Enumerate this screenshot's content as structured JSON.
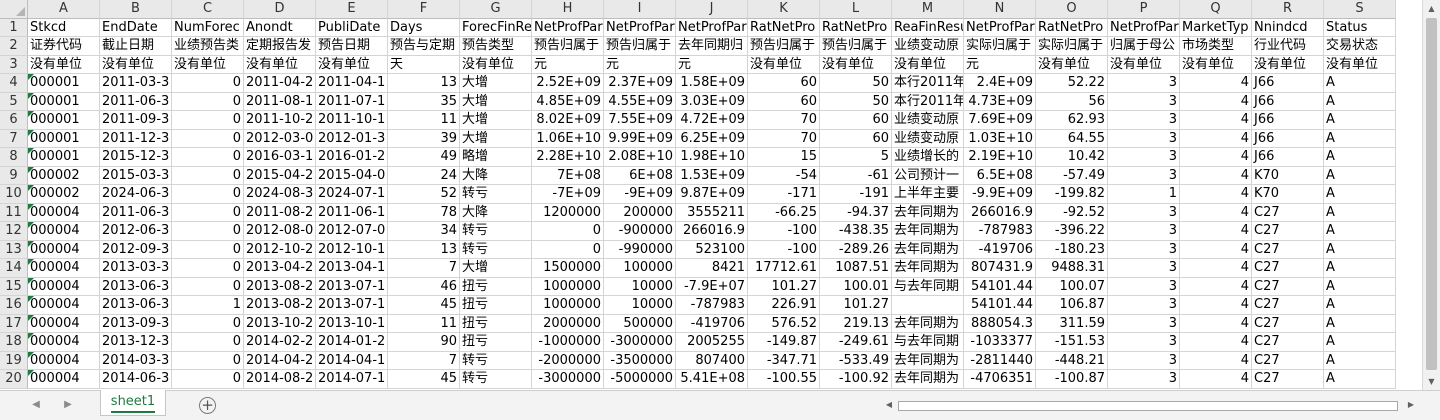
{
  "columns": [
    "A",
    "B",
    "C",
    "D",
    "E",
    "F",
    "G",
    "H",
    "I",
    "J",
    "K",
    "L",
    "M",
    "N",
    "O",
    "P",
    "Q",
    "R",
    "S"
  ],
  "rows": [
    [
      "Stkcd",
      "EndDate",
      "NumForec",
      "Anondt",
      "PubliDate",
      "Days",
      "ForecFinRe",
      "NetProfPar",
      "NetProfPar",
      "NetProfPar",
      "RatNetPro",
      "RatNetPro",
      "ReaFinResu",
      "NetProfPar",
      "RatNetPro",
      "NetProfPar",
      "MarketTyp",
      "Nnindcd",
      "Status"
    ],
    [
      "证券代码",
      "截止日期",
      "业绩预告类",
      "定期报告发",
      "预告日期",
      "预告与定期",
      "预告类型",
      "预告归属于",
      "预告归属于",
      "去年同期归",
      "预告归属于",
      "预告归属于",
      "业绩变动原",
      "实际归属于",
      "实际归属于",
      "归属于母公",
      "市场类型",
      "行业代码",
      "交易状态"
    ],
    [
      "没有单位",
      "没有单位",
      "没有单位",
      "没有单位",
      "没有单位",
      "天",
      "没有单位",
      "元",
      "元",
      "元",
      "没有单位",
      "没有单位",
      "没有单位",
      "元",
      "没有单位",
      "没有单位",
      "没有单位",
      "没有单位",
      "没有单位"
    ],
    [
      "000001",
      "2011-03-3",
      "0",
      "2011-04-2",
      "2011-04-1",
      "13",
      "大增",
      "2.52E+09",
      "2.37E+09",
      "1.58E+09",
      "60",
      "50",
      "本行2011年",
      "2.4E+09",
      "52.22",
      "3",
      "4",
      "J66",
      "A"
    ],
    [
      "000001",
      "2011-06-3",
      "0",
      "2011-08-1",
      "2011-07-1",
      "35",
      "大增",
      "4.85E+09",
      "4.55E+09",
      "3.03E+09",
      "60",
      "50",
      "本行2011年",
      "4.73E+09",
      "56",
      "3",
      "4",
      "J66",
      "A"
    ],
    [
      "000001",
      "2011-09-3",
      "0",
      "2011-10-2",
      "2011-10-1",
      "11",
      "大增",
      "8.02E+09",
      "7.55E+09",
      "4.72E+09",
      "70",
      "60",
      "业绩变动原",
      "7.69E+09",
      "62.93",
      "3",
      "4",
      "J66",
      "A"
    ],
    [
      "000001",
      "2011-12-3",
      "0",
      "2012-03-0",
      "2012-01-3",
      "39",
      "大增",
      "1.06E+10",
      "9.99E+09",
      "6.25E+09",
      "70",
      "60",
      "业绩变动原",
      "1.03E+10",
      "64.55",
      "3",
      "4",
      "J66",
      "A"
    ],
    [
      "000001",
      "2015-12-3",
      "0",
      "2016-03-1",
      "2016-01-2",
      "49",
      "略增",
      "2.28E+10",
      "2.08E+10",
      "1.98E+10",
      "15",
      "5",
      "业绩增长的",
      "2.19E+10",
      "10.42",
      "3",
      "4",
      "J66",
      "A"
    ],
    [
      "000002",
      "2015-03-3",
      "0",
      "2015-04-2",
      "2015-04-0",
      "24",
      "大降",
      "7E+08",
      "6E+08",
      "1.53E+09",
      "-54",
      "-61",
      "公司预计一",
      "6.5E+08",
      "-57.49",
      "3",
      "4",
      "K70",
      "A"
    ],
    [
      "000002",
      "2024-06-3",
      "0",
      "2024-08-3",
      "2024-07-1",
      "52",
      "转亏",
      "-7E+09",
      "-9E+09",
      "9.87E+09",
      "-171",
      "-191",
      "上半年主要",
      "-9.9E+09",
      "-199.82",
      "1",
      "4",
      "K70",
      "A"
    ],
    [
      "000004",
      "2011-06-3",
      "0",
      "2011-08-2",
      "2011-06-1",
      "78",
      "大降",
      "1200000",
      "200000",
      "3555211",
      "-66.25",
      "-94.37",
      "去年同期为",
      "266016.9",
      "-92.52",
      "3",
      "4",
      "C27",
      "A"
    ],
    [
      "000004",
      "2012-06-3",
      "0",
      "2012-08-0",
      "2012-07-0",
      "34",
      "转亏",
      "0",
      "-900000",
      "266016.9",
      "-100",
      "-438.35",
      "去年同期为",
      "-787983",
      "-396.22",
      "3",
      "4",
      "C27",
      "A"
    ],
    [
      "000004",
      "2012-09-3",
      "0",
      "2012-10-2",
      "2012-10-1",
      "13",
      "转亏",
      "0",
      "-990000",
      "523100",
      "-100",
      "-289.26",
      "去年同期为",
      "-419706",
      "-180.23",
      "3",
      "4",
      "C27",
      "A"
    ],
    [
      "000004",
      "2013-03-3",
      "0",
      "2013-04-2",
      "2013-04-1",
      "7",
      "大增",
      "1500000",
      "100000",
      "8421",
      "17712.61",
      "1087.51",
      "去年同期为",
      "807431.9",
      "9488.31",
      "3",
      "4",
      "C27",
      "A"
    ],
    [
      "000004",
      "2013-06-3",
      "0",
      "2013-08-2",
      "2013-07-1",
      "46",
      "扭亏",
      "1000000",
      "10000",
      "-7.9E+07",
      "101.27",
      "100.01",
      "与去年同期",
      "54101.44",
      "100.07",
      "3",
      "4",
      "C27",
      "A"
    ],
    [
      "000004",
      "2013-06-3",
      "1",
      "2013-08-2",
      "2013-07-1",
      "45",
      "扭亏",
      "1000000",
      "10000",
      "-787983",
      "226.91",
      "101.27",
      "",
      "54101.44",
      "106.87",
      "3",
      "4",
      "C27",
      "A"
    ],
    [
      "000004",
      "2013-09-3",
      "0",
      "2013-10-2",
      "2013-10-1",
      "11",
      "扭亏",
      "2000000",
      "500000",
      "-419706",
      "576.52",
      "219.13",
      "去年同期为",
      "888054.3",
      "311.59",
      "3",
      "4",
      "C27",
      "A"
    ],
    [
      "000004",
      "2013-12-3",
      "0",
      "2014-02-2",
      "2014-01-2",
      "90",
      "扭亏",
      "-1000000",
      "-3000000",
      "2005255",
      "-149.87",
      "-249.61",
      "与去年同期",
      "-1033377",
      "-151.53",
      "3",
      "4",
      "C27",
      "A"
    ],
    [
      "000004",
      "2014-03-3",
      "0",
      "2014-04-2",
      "2014-04-1",
      "7",
      "转亏",
      "-2000000",
      "-3500000",
      "807400",
      "-347.71",
      "-533.49",
      "去年同期为",
      "-2811440",
      "-448.21",
      "3",
      "4",
      "C27",
      "A"
    ],
    [
      "000004",
      "2014-06-3",
      "0",
      "2014-08-2",
      "2014-07-1",
      "45",
      "转亏",
      "-3000000",
      "-5000000",
      "5.41E+08",
      "-100.55",
      "-100.92",
      "去年同期为",
      "-4706351",
      "-100.87",
      "3",
      "4",
      "C27",
      "A"
    ]
  ],
  "sheet_tab": "sheet1",
  "add_sheet_label": "+",
  "icons": {
    "prev": "◀",
    "next": "▶",
    "up": "▲",
    "down": "▼",
    "left": "◀",
    "right": "▶"
  },
  "accent_color": "#1e7b3e"
}
